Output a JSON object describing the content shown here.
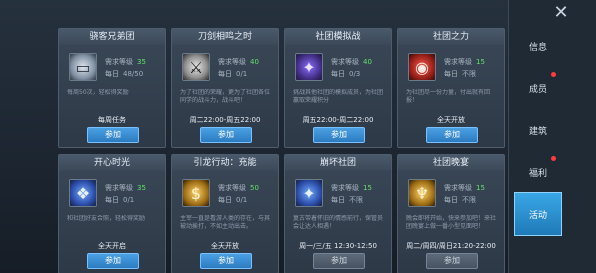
{
  "close_glyph": "✕",
  "side_tabs": [
    {
      "label": "信息",
      "dot": false
    },
    {
      "label": "成员",
      "dot": true
    },
    {
      "label": "建筑",
      "dot": false
    },
    {
      "label": "福利",
      "dot": true
    },
    {
      "label": "活动",
      "dot": false,
      "active": true
    }
  ],
  "cards": [
    {
      "title": "骁客兄弟团",
      "icon_name": "cards-icon",
      "icon_glyph": "▭",
      "icon_color": "silver",
      "req_label": "需求等级",
      "req_level": "35",
      "today_label": "每日",
      "today_value": "48/50",
      "desc": "每周50次，轻松得奖励",
      "schedule": "每周任务",
      "button": "参加",
      "button_disabled": false
    },
    {
      "title": "刀剑相鸣之时",
      "icon_name": "sword-emblem-icon",
      "icon_glyph": "⚔",
      "icon_color": "crest",
      "req_label": "需求等级",
      "req_level": "40",
      "today_label": "每日",
      "today_value": "0/1",
      "desc": "为了社团的荣耀，更为了社团各位同学的战斗力，战斗吧！",
      "schedule": "周二22:00-周五22:00",
      "button": "参加",
      "button_disabled": false
    },
    {
      "title": "社团模拟战",
      "icon_name": "purple-crest-icon",
      "icon_glyph": "✦",
      "icon_color": "purple",
      "req_label": "需求等级",
      "req_level": "40",
      "today_label": "每日",
      "today_value": "0/3",
      "desc": "挑战其他社团的模拟成员，为社团赢取荣耀积分",
      "schedule": "周五22:00-周二22:00",
      "button": "参加",
      "button_disabled": false
    },
    {
      "title": "社团之力",
      "icon_name": "power-icon",
      "icon_glyph": "◉",
      "icon_color": "red",
      "req_label": "需求等级",
      "req_level": "15",
      "today_label": "每日",
      "today_value": "不限",
      "desc": "为社团尽一份力量，付出就有回报！",
      "schedule": "全天开放",
      "button": "参加",
      "button_disabled": false
    },
    {
      "title": "开心时光",
      "icon_name": "photos-icon",
      "icon_glyph": "❖",
      "icon_color": "blue",
      "req_label": "需求等级",
      "req_level": "35",
      "today_label": "每日",
      "today_value": "0/1",
      "desc": "和社团好友合照，轻松得奖励",
      "schedule": "全天开启",
      "button": "参加",
      "button_disabled": false
    },
    {
      "title": "引龙行动：充能",
      "icon_name": "dragon-coin-icon",
      "icon_glyph": "$",
      "icon_color": "gold",
      "req_label": "需求等级",
      "req_level": "50",
      "today_label": "每日",
      "today_value": "0/1",
      "desc": "主宰一直是看游人类的存在，与其被动挨打，不如主动出击。",
      "schedule": "全天开放",
      "button": "参加",
      "button_disabled": false
    },
    {
      "title": "崩坏社团",
      "icon_name": "blue-crest-icon",
      "icon_glyph": "✦",
      "icon_color": "blue",
      "req_label": "需求等级",
      "req_level": "15",
      "today_label": "每日",
      "today_value": "不限",
      "desc": "复古带着怀旧的情感前行，保管员会让达人相遇！",
      "schedule": "周一/三/五 12:30-12:50",
      "button": "参加",
      "button_disabled": true
    },
    {
      "title": "社团晚宴",
      "icon_name": "wine-glass-icon",
      "icon_glyph": "♆",
      "icon_color": "gold",
      "req_label": "需求等级",
      "req_level": "15",
      "today_label": "每日",
      "today_value": "不限",
      "desc": "晚会即将开始，快来参加吧！来社团晚宴上做一番小型见面吧！",
      "schedule": "周二/周四/周日21:20-22:00",
      "button": "参加",
      "button_disabled": true
    }
  ]
}
